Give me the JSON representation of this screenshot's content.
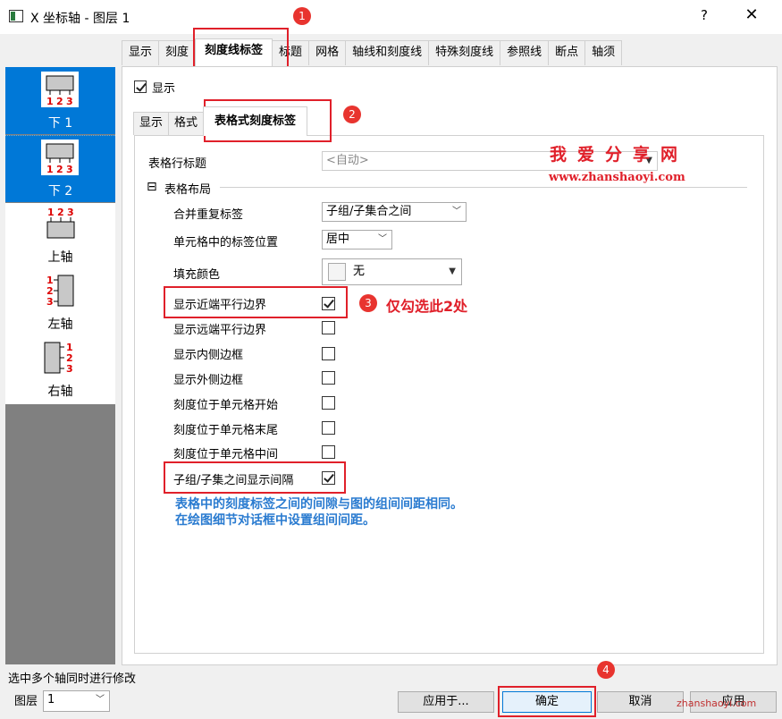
{
  "window": {
    "title": "X 坐标轴 - 图层 1",
    "help_label": "?",
    "close_label": "✕"
  },
  "top_tabs": [
    {
      "label": "显示"
    },
    {
      "label": "刻度"
    },
    {
      "label": "刻度线标签"
    },
    {
      "label": "标题"
    },
    {
      "label": "网格"
    },
    {
      "label": "轴线和刻度线"
    },
    {
      "label": "特殊刻度线"
    },
    {
      "label": "参照线"
    },
    {
      "label": "断点"
    },
    {
      "label": "轴须"
    }
  ],
  "axis_list": [
    {
      "label": "下 1",
      "icon_text": "123"
    },
    {
      "label": "下 2",
      "icon_text": "123"
    },
    {
      "label": "上轴",
      "icon_text": "123"
    },
    {
      "label": "左轴",
      "icon_text": "123"
    },
    {
      "label": "右轴",
      "icon_text": "123"
    }
  ],
  "show": {
    "label": "显示",
    "checked": true
  },
  "sub_tabs": [
    {
      "label": "显示"
    },
    {
      "label": "格式"
    },
    {
      "label": "表格式刻度标签"
    }
  ],
  "form": {
    "row_title_label": "表格行标题",
    "row_title_value": "<自动>",
    "layout_group": "表格布局",
    "collapse_symbol": "⊟",
    "merge_label": "合并重复标签",
    "merge_value": "子组/子集合之间",
    "position_label": "单元格中的标签位置",
    "position_value": "居中",
    "fill_label": "填充颜色",
    "fill_value": "无",
    "checks": [
      {
        "label": "显示近端平行边界",
        "checked": true
      },
      {
        "label": "显示远端平行边界",
        "checked": false
      },
      {
        "label": "显示内侧边框",
        "checked": false
      },
      {
        "label": "显示外侧边框",
        "checked": false
      },
      {
        "label": "刻度位于单元格开始",
        "checked": false
      },
      {
        "label": "刻度位于单元格末尾",
        "checked": false
      },
      {
        "label": "刻度位于单元格中间",
        "checked": false
      },
      {
        "label": "子组/子集之间显示间隔",
        "checked": true
      }
    ]
  },
  "annotations": {
    "badge1": "1",
    "badge2": "2",
    "badge3": "3",
    "badge4": "4",
    "note3": "仅勾选此2处",
    "blue_note_line1": "表格中的刻度标签之间的间隙与图的组间间距相同。",
    "blue_note_line2": "在绘图细节对话框中设置组间间距。",
    "watermark_cn": "我爱分享网",
    "watermark_url": "www.zhanshaoyi.com",
    "bottom_watermark": "zhanshaoyi.com"
  },
  "footer": {
    "status_text": "选中多个轴同时进行修改",
    "layer_label": "图层",
    "layer_value": "1",
    "apply_to_label": "应用于...",
    "ok_label": "确定",
    "cancel_label": "取消",
    "apply_label": "应用"
  },
  "colors": {
    "accent": "#0078d7",
    "annotation_red": "#e0202a",
    "note_blue": "#2a7bd0"
  }
}
